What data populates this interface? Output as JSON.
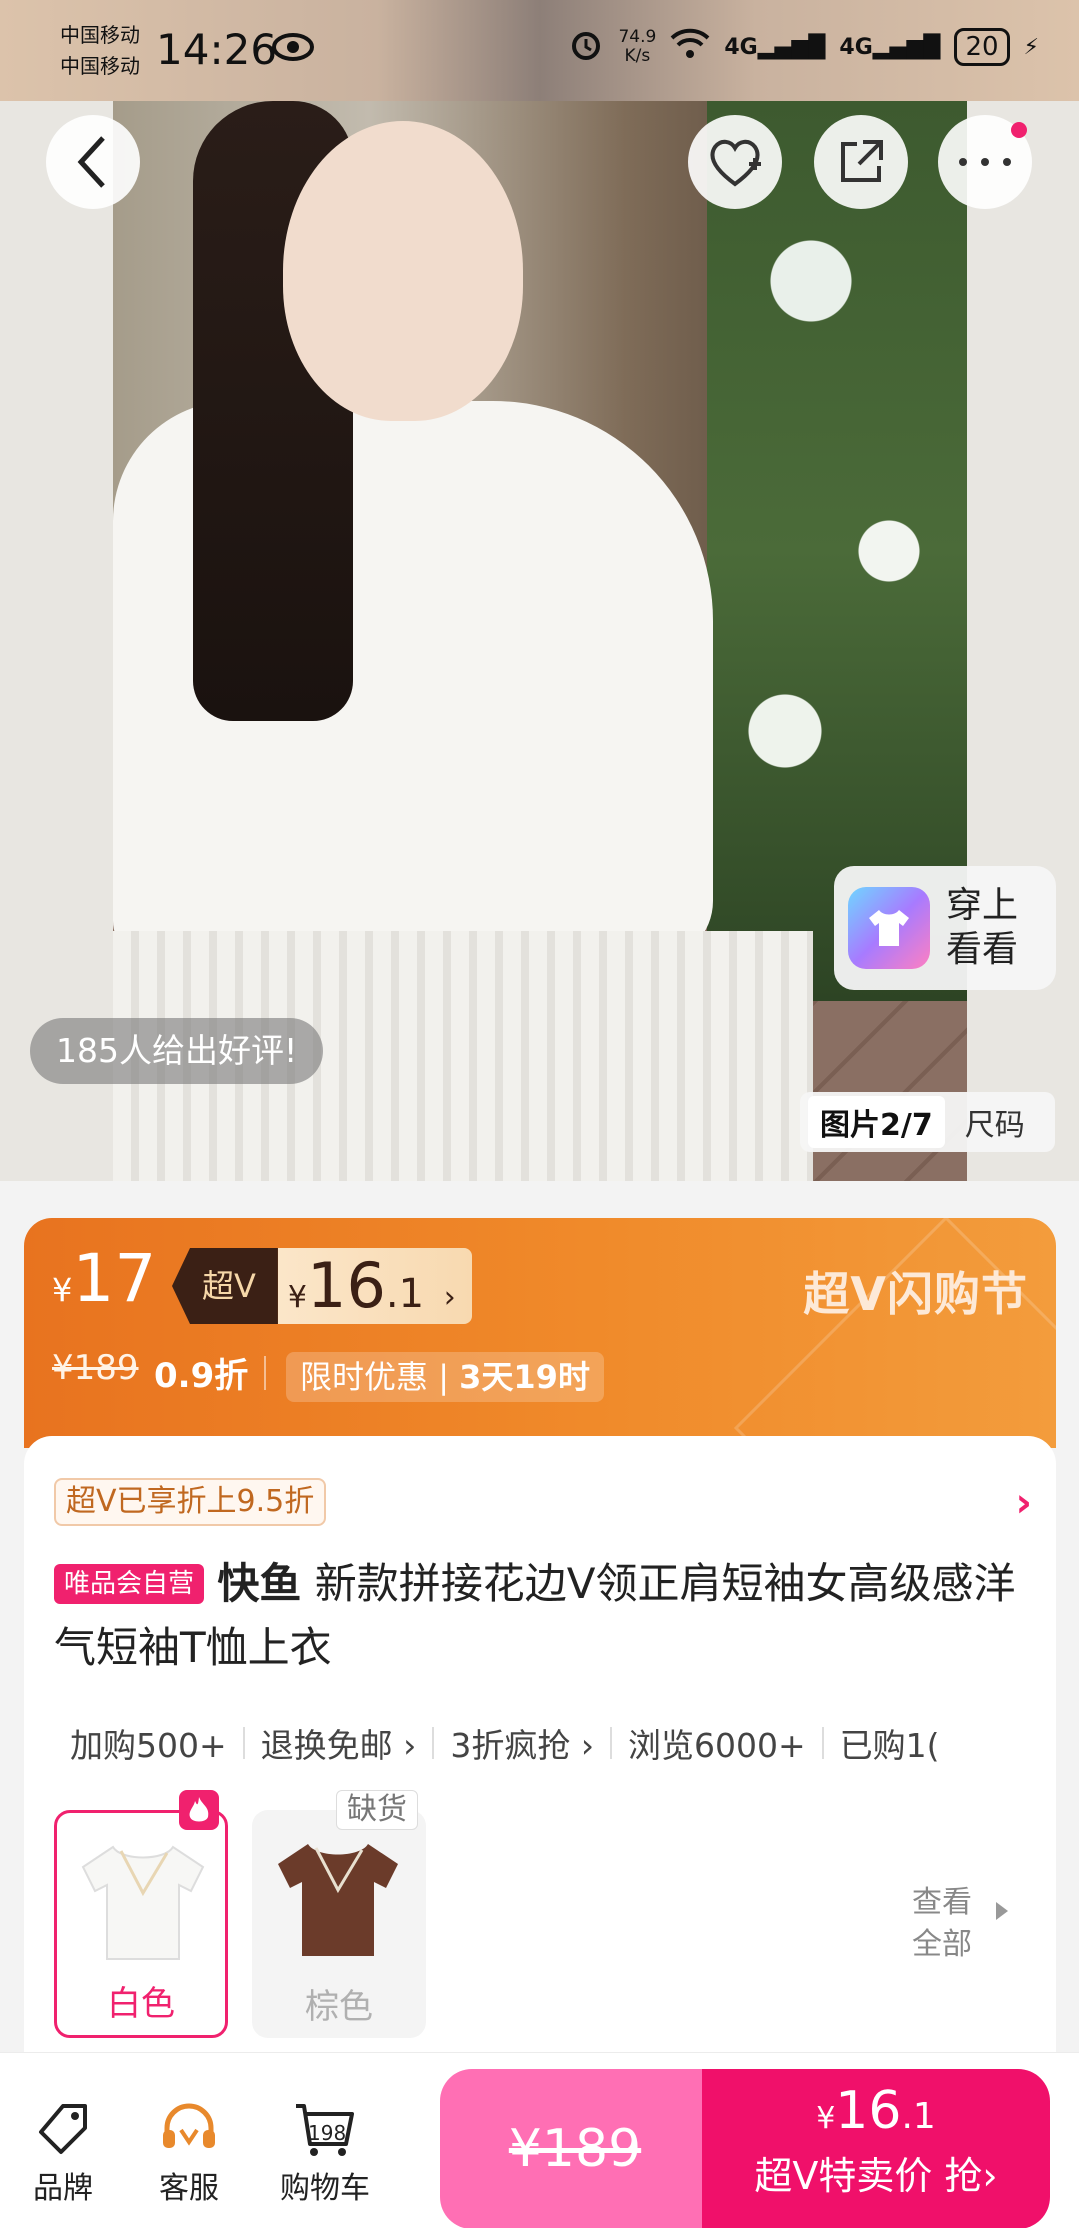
{
  "status": {
    "carrier1": "中国移动",
    "carrier2": "中国移动",
    "time": "14:26",
    "speed_value": "74.9",
    "speed_unit": "K/s",
    "net1": "4G",
    "net2": "4G",
    "battery": "20"
  },
  "hero": {
    "rating_pill": "185人给出好评!",
    "tryon_line1": "穿上",
    "tryon_line2": "看看",
    "tab_image": "图片2/7",
    "tab_size": "尺码"
  },
  "price": {
    "currency": "¥",
    "main_price": "17",
    "vip_tag": "超V",
    "vip_price_int": "16",
    "vip_price_dec": ".1",
    "festival": "超V闪购节",
    "original": "¥189",
    "discount": "0.9折",
    "limited_label": "限时优惠",
    "limited_time": "3天19时"
  },
  "product": {
    "svip_note": "超V已享折上9.5折",
    "self_tag": "唯品会自营",
    "brand": "快鱼",
    "title": "新款拼接花边V领正肩短袖女高级感洋气短袖T恤上衣",
    "features": [
      "加购500+",
      "退换免邮 ›",
      "3折疯抢 ›",
      "浏览6000+",
      "已购1("
    ],
    "colors": [
      "白色",
      "棕色"
    ],
    "out_of_stock": "缺货",
    "view_all": "查看全部"
  },
  "bottom": {
    "tab_brand": "品牌",
    "tab_service": "客服",
    "tab_cart": "购物车",
    "cart_count": "198",
    "orig_price": "¥189",
    "buy_price_int": "16",
    "buy_price_dec": ".1",
    "buy_label": "超V特卖价 抢›"
  },
  "colors": {
    "accent": "#f0216e",
    "orange": "#f08a2a",
    "pink_button": "#ff6fb4"
  }
}
